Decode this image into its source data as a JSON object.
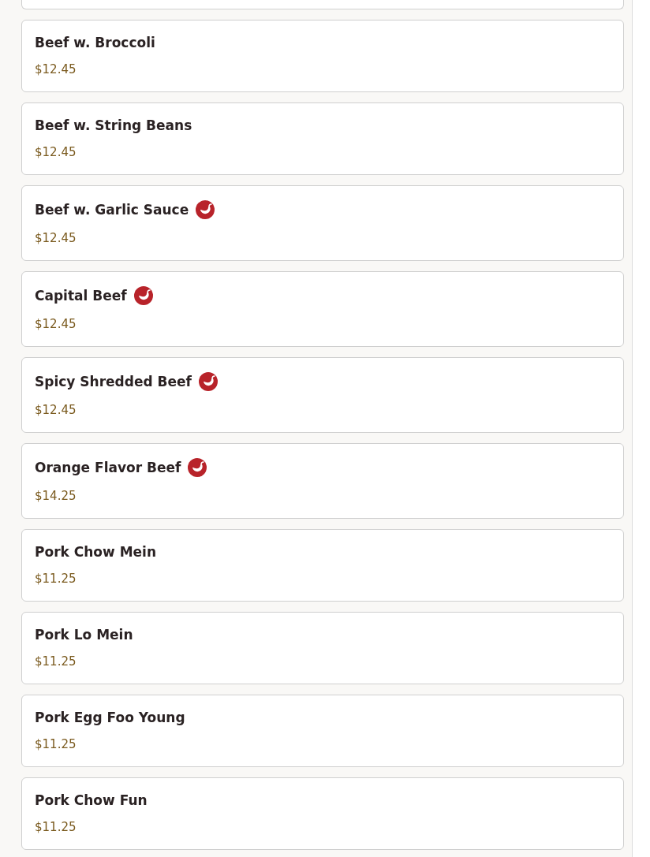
{
  "items": [
    {
      "name": "Beef w. Broccoli",
      "price": "$12.45",
      "spicy": false
    },
    {
      "name": "Beef w. String Beans",
      "price": "$12.45",
      "spicy": false
    },
    {
      "name": "Beef w. Garlic Sauce",
      "price": "$12.45",
      "spicy": true
    },
    {
      "name": "Capital Beef",
      "price": "$12.45",
      "spicy": true
    },
    {
      "name": "Spicy Shredded Beef",
      "price": "$12.45",
      "spicy": true
    },
    {
      "name": "Orange Flavor Beef",
      "price": "$14.25",
      "spicy": true
    },
    {
      "name": "Pork Chow Mein",
      "price": "$11.25",
      "spicy": false
    },
    {
      "name": "Pork Lo Mein",
      "price": "$11.25",
      "spicy": false
    },
    {
      "name": "Pork Egg Foo Young",
      "price": "$11.25",
      "spicy": false
    },
    {
      "name": "Pork Chow Fun",
      "price": "$11.25",
      "spicy": false
    }
  ]
}
